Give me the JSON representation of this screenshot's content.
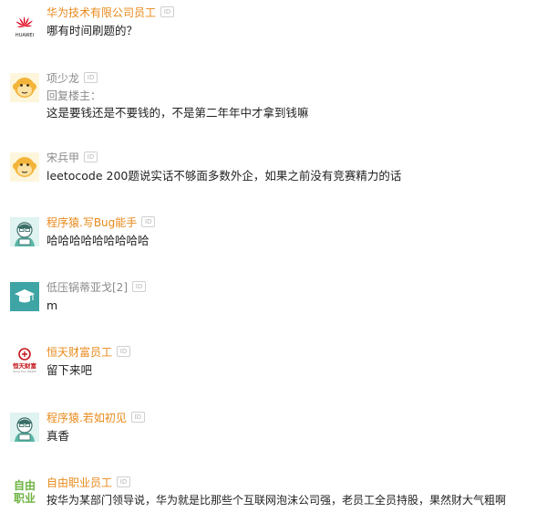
{
  "comments": [
    {
      "author": "华为技术有限公司员工",
      "author_color": "#e8891a",
      "id_badge": "ID",
      "text": "哪有时间刷题的？",
      "avatar": "huawei-logo",
      "avatar_caption": "HUAWEI"
    },
    {
      "author": "项少龙",
      "author_color": "#8a8a8a",
      "id_badge": "ID",
      "reply_label": "回复楼主：",
      "text": "这是要钱还是不要钱的，不是第二年年中才拿到钱嘛",
      "avatar": "monkey-avatar"
    },
    {
      "author": "宋兵甲",
      "author_color": "#8a8a8a",
      "id_badge": "ID",
      "text": "leetocode 200题说实话不够面多数外企，如果之前没有竞赛精力的话",
      "avatar": "monkey-avatar"
    },
    {
      "author": "程序猿.写Bug能手",
      "author_color": "#e8891a",
      "id_badge": "ID",
      "text": "哈哈哈哈哈哈哈哈哈",
      "avatar": "programmer-avatar"
    },
    {
      "author": "低压锅蒂亚戈[2]",
      "author_color": "#8a8a8a",
      "id_badge": "ID",
      "text": "m",
      "avatar": "graduation-cap-avatar"
    },
    {
      "author": "恒天财富员工",
      "author_color": "#e8891a",
      "id_badge": "ID",
      "text": "留下来吧",
      "avatar": "hengtian-logo",
      "avatar_caption": "恒天财富",
      "avatar_subcaption": "Heng Tian Wealth"
    },
    {
      "author": "程序猿.若如初见",
      "author_color": "#e8891a",
      "id_badge": "ID",
      "text": "真香",
      "avatar": "programmer-avatar"
    },
    {
      "author": "自由职业员工",
      "author_color": "#e8891a",
      "id_badge": "ID",
      "text": "按华为某部门领导说，华为就是比那些个互联网泡沫公司强，老员工全员持股，果然财大气粗啊",
      "avatar": "freelance-logo",
      "avatar_caption_line1": "自由",
      "avatar_caption_line2": "职业"
    }
  ]
}
